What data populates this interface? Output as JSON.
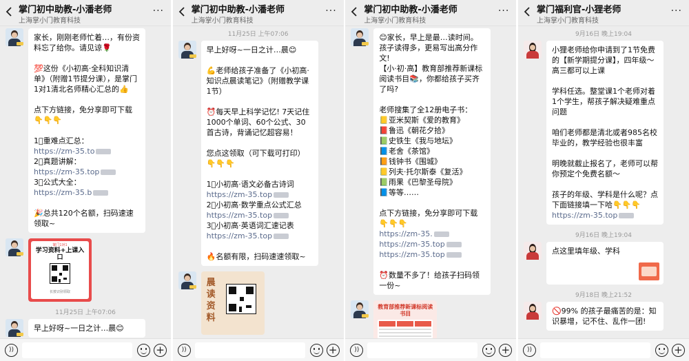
{
  "panels": [
    {
      "title": "掌门初中助教-小潘老师",
      "subtitle": "上海掌小门教育科技",
      "messages": [
        [
          "家长，刚刚老师忙着…，有份资料忘了给你。请见谅🌹",
          "",
          "💯这份《小初高·全科知识清单》（附赠1节提分课），是掌门1对1清北名师精心汇总的👍",
          "",
          "点下方链接，免分享即可下载",
          "👇👇👇",
          "",
          "1⃣重难点汇总：",
          "https://zm-35.to",
          "2⃣真题讲解：",
          "https://zm-35.top",
          "3⃣公式大全：",
          "https://zm-35.b",
          "",
          "🎉总共120个名额，扫码速速领取~"
        ]
      ],
      "card": {
        "badge": "掌门1对1",
        "title": "学习资料+上课入口",
        "caption": "长按识别领取"
      },
      "timestamp": "11月25日 上午07:06",
      "last_message": "早上好呀~一日之计…晨😊"
    },
    {
      "title": "掌门初中助教-小潘老师",
      "subtitle": "上海掌小门教育科技",
      "timestamp": "11月25日 上午07:06",
      "messages": [
        [
          "早上好呀~一日之计…晨😊",
          "",
          "💪老师给孩子准备了《小初高·知识点晨读笔记》（附赠教学课1节）",
          "",
          "⏰每天早上科学记忆! 7天记住1000个单词、60个公式、30首古诗，背诵记忆超容易！",
          "",
          "您点这领取（可下载可打印）",
          "👇👇👇",
          "",
          "1⃣小初高·语文必备古诗词",
          "https://zm-35.top",
          "2⃣小初高·数学重点公式汇总",
          "https://zm-35.top",
          "3⃣小初高·英语词汇速记表",
          "https://zm-35.top",
          "",
          "🔥名额有限，扫码速速领取~"
        ]
      ],
      "card": {
        "title": "晨读资料"
      }
    },
    {
      "title": "掌门初中助教-小潘老师",
      "subtitle": "上海掌小门教育科技",
      "messages": [
        [
          "😊家长，早上是最…读时间。孩子读得多，更易写出高分作文!",
          "【小·初·高】教育部推荐新课标阅读书目📚，你都给孩子买齐了吗?",
          "",
          "老师搜集了全12册电子书：",
          "📒亚米契斯《爱的教育》",
          "📕鲁迅《朝花夕拾》",
          "📗史铁生《我与地坛》",
          "📘老舍《茶馆》",
          "📙钱钟书《围城》",
          "📒列夫·托尔斯泰《复活》",
          "📗雨果《巴黎圣母院》",
          "📘等等……",
          "",
          "点下方链接，免分享即可下载",
          "👇👇👇",
          "https://zm-35.",
          "https://zm-35.top",
          "https://zm-35.top",
          "",
          "⏰数量不多了！给孩子扫码领一份~"
        ]
      ],
      "card": {
        "title": "教育部推荐新课标阅读书目"
      }
    },
    {
      "title": "掌门福利官-小狸老师",
      "subtitle": "上海掌小门教育科技",
      "timestamps": [
        "9月16日 晚上19:04",
        "9月16日 晚上19:04",
        "9月18日 晚上21:52"
      ],
      "messages": [
        [
          "小狸老师给你申请到了1节免费的【新学期提分课】，四年级～高三都可以上课",
          "",
          "学科任选。整堂课1个老师对着1个学生，帮孩子解决疑难重点问题",
          "",
          "咱们老师都是清北或者985名校毕业的，教学经验也很丰富",
          "",
          "明晚就截止报名了，老师可以帮你预定个免费名额～",
          "",
          "孩子的年级、学科是什么呢？点下面链接填一下哈👇👇👇",
          "https://zm-35.top"
        ],
        [
          "点这里填年级、学科"
        ],
        [
          "🚫99% 的孩子最痛苦的是：知识暴增，记不住、乱作一团!"
        ]
      ]
    }
  ],
  "icons": {
    "back": "back-arrow-icon",
    "more": "more-icon",
    "voice": "voice-icon",
    "emoji": "emoji-icon",
    "plus": "plus-icon"
  }
}
